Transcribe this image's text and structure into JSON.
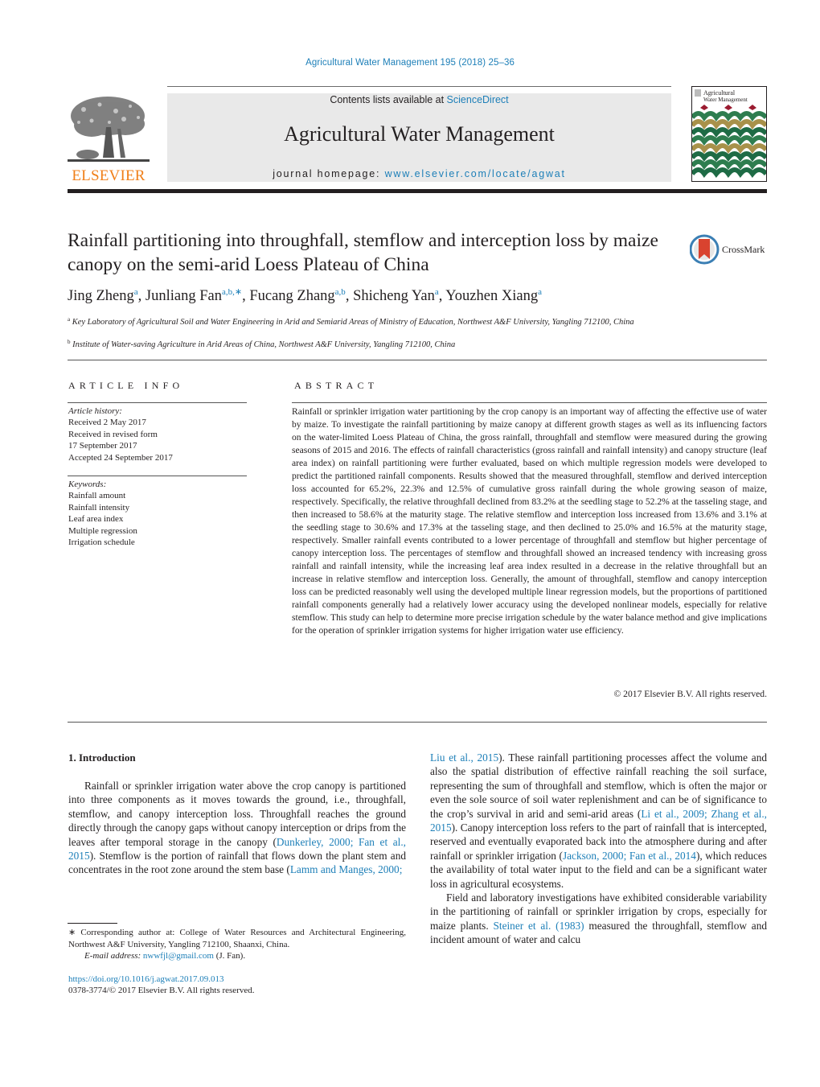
{
  "running_head": "Agricultural Water Management 195 (2018) 25–36",
  "banner": {
    "contents_prefix": "Contents lists available at ",
    "contents_link": "ScienceDirect",
    "journal_title": "Agricultural Water Management",
    "homepage_prefix": "journal homepage: ",
    "homepage_link": "www.elsevier.com/locate/agwat"
  },
  "publisher_logo": {
    "wordmark": "ELSEVIER",
    "color": "#f07f19"
  },
  "cover": {
    "title_line1": "Agricultural",
    "title_line2": "Water Management"
  },
  "article": {
    "title": "Rainfall partitioning into throughfall, stemflow and interception loss by maize canopy on the semi-arid Loess Plateau of China",
    "crossmark_label": "CrossMark",
    "authors": [
      {
        "name": "Jing Zheng",
        "sup": "a",
        "sep": ", "
      },
      {
        "name": "Junliang Fan",
        "sup": "a,b,∗",
        "sep": ", "
      },
      {
        "name": "Fucang Zhang",
        "sup": "a,b",
        "sep": ", "
      },
      {
        "name": "Shicheng Yan",
        "sup": "a",
        "sep": ", "
      },
      {
        "name": "Youzhen Xiang",
        "sup": "a",
        "sep": ""
      }
    ],
    "affiliations": [
      {
        "key": "a",
        "text": "Key Laboratory of Agricultural Soil and Water Engineering in Arid and Semiarid Areas of Ministry of Education, Northwest A&F University, Yangling 712100, China"
      },
      {
        "key": "b",
        "text": "Institute of Water-saving Agriculture in Arid Areas of China, Northwest A&F University, Yangling 712100, China"
      }
    ]
  },
  "article_info": {
    "heading": "ARTICLE INFO",
    "history_label": "Article history:",
    "history": [
      "Received 2 May 2017",
      "Received in revised form",
      "17 September 2017",
      "Accepted 24 September 2017"
    ],
    "keywords_label": "Keywords:",
    "keywords": [
      "Rainfall amount",
      "Rainfall intensity",
      "Leaf area index",
      "Multiple regression",
      "Irrigation schedule"
    ]
  },
  "abstract": {
    "heading": "ABSTRACT",
    "text": "Rainfall or sprinkler irrigation water partitioning by the crop canopy is an important way of affecting the effective use of water by maize. To investigate the rainfall partitioning by maize canopy at different growth stages as well as its influencing factors on the water-limited Loess Plateau of China, the gross rain­fall, throughfall and stemflow were measured during the growing seasons of 2015 and 2016. The effects of rainfall characteristics (gross rainfall and rainfall intensity) and canopy structure (leaf area index) on rainfall partitioning were further evaluated, based on which multiple regression models were developed to predict the partitioned rainfall components. Results showed that the measured throughfall, stemflow and derived interception loss accounted for 65.2%, 22.3% and 12.5% of cumulative gross rainfall during the whole growing season of maize, respectively. Specifically, the relative throughfall declined from 83.2% at the seedling stage to 52.2% at the tasseling stage, and then increased to 58.6% at the maturity stage. The relative stemflow and interception loss increased from 13.6% and 3.1% at the seedling stage to 30.6% and 17.3% at the tasseling stage, and then declined to 25.0% and 16.5% at the maturity stage, respectively. Smaller rainfall events contributed to a lower percentage of throughfall and stemflow but higher per­centage of canopy interception loss. The percentages of stemflow and throughfall showed an increased tendency with increasing gross rainfall and rainfall intensity, while the increasing leaf area index resulted in a decrease in the relative throughfall but an increase in relative stemflow and interception loss. Gen­erally, the amount of throughfall, stemflow and canopy interception loss can be predicted reasonably well using the developed multiple linear regression models, but the proportions of partitioned rainfall components generally had a relatively lower accuracy using the developed nonlinear models, especially for relative stemflow. This study can help to determine more precise irrigation schedule by the water bal­ance method and give implications for the operation of sprinkler irrigation systems for higher irrigation water use efficiency.",
    "copyright": "© 2017 Elsevier B.V. All rights reserved."
  },
  "introduction": {
    "heading": "1.  Introduction",
    "left_p1": [
      {
        "t": "Rainfall or sprinkler irrigation water above the crop canopy is partitioned into three components as it moves towards the ground, i.e., throughfall, stemflow, and canopy interception loss. Through­fall reaches the ground directly through the canopy gaps without canopy interception or drips from the leaves after temporal storage in the canopy ("
      },
      {
        "link": "Dunkerley, 2000; Fan et al., 2015"
      },
      {
        "t": "). Stemflow is the portion of rainfall that flows down the plant stem and concentrates in the root zone around the stem base ("
      },
      {
        "link": "Lamm and Manges, 2000;"
      }
    ],
    "right_p1": [
      {
        "link": "Liu et al., 2015"
      },
      {
        "t": "). These rainfall partitioning processes affect the vol­ume and also the spatial distribution of effective rainfall reaching the soil surface, representing the sum of throughfall and stemflow, which is often the major or even the sole source of soil water replen­ishment and can be of significance to the crop’s survival in arid and semi-arid areas ("
      },
      {
        "link": "Li et al., 2009; Zhang et al., 2015"
      },
      {
        "t": "). Canopy intercep­tion loss refers to the part of rainfall that is intercepted, reserved and eventually evaporated back into the atmosphere during and after rainfall or sprinkler irrigation ("
      },
      {
        "link": "Jackson, 2000; Fan et al., 2014"
      },
      {
        "t": "), which reduces the availability of total water input to the field and can be a significant water loss in agricultural ecosystems."
      }
    ],
    "right_p2": [
      {
        "t": "Field and laboratory investigations have exhibited considerable variability in the partitioning of rainfall or sprinkler irrigation by crops, especially for maize plants. "
      },
      {
        "link": "Steiner et al. (1983)"
      },
      {
        "t": " measured the throughfall, stemflow and incident amount of water and calcu­"
      }
    ]
  },
  "footnotes": {
    "corresponding": "∗  Corresponding author at: College of Water Resources and Architectural Engi­neering, Northwest A&F University, Yangling 712100, Shaanxi, China.",
    "email_label": "E-mail address: ",
    "email": "nwwfjl@gmail.com",
    "email_suffix": " (J. Fan).",
    "doi": "https://doi.org/10.1016/j.agwat.2017.09.013",
    "issn": "0378-3774/© 2017 Elsevier B.V. All rights reserved."
  },
  "colors": {
    "link": "#1d7fb8",
    "text": "#231f20",
    "banner_bg": "#e9e9e9",
    "elsevier_orange": "#f07f19"
  }
}
